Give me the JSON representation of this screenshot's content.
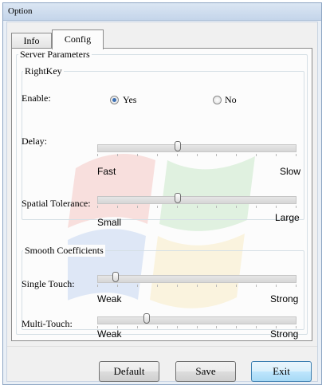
{
  "window": {
    "title": "Option"
  },
  "tabs": [
    {
      "label": "Info",
      "selected": false
    },
    {
      "label": "Config",
      "selected": true
    }
  ],
  "server_parameters": {
    "title": "Server Parameters",
    "rightkey": {
      "title": "RightKey",
      "enable": {
        "label": "Enable:",
        "options": [
          "Yes",
          "No"
        ],
        "selected": "Yes"
      },
      "delay": {
        "label": "Delay:",
        "min_label": "Fast",
        "max_label": "Slow",
        "level": 0.4
      },
      "spatial_tolerance": {
        "label": "Spatial Tolerance:",
        "min_label": "Small",
        "max_label": "Large",
        "level": 0.4
      }
    },
    "smooth": {
      "title": "Smooth Coefficients",
      "single_touch": {
        "label": "Single Touch:",
        "min_label": "Weak",
        "max_label": "Strong",
        "level": 0.08
      },
      "multi_touch": {
        "label": "Multi-Touch:",
        "min_label": "Weak",
        "max_label": "Strong",
        "level": 0.24
      }
    }
  },
  "buttons": {
    "default": "Default",
    "save": "Save",
    "exit": "Exit"
  },
  "colors": {
    "accent": "#3c6fb3",
    "focus_button": "#a7d9f5"
  }
}
